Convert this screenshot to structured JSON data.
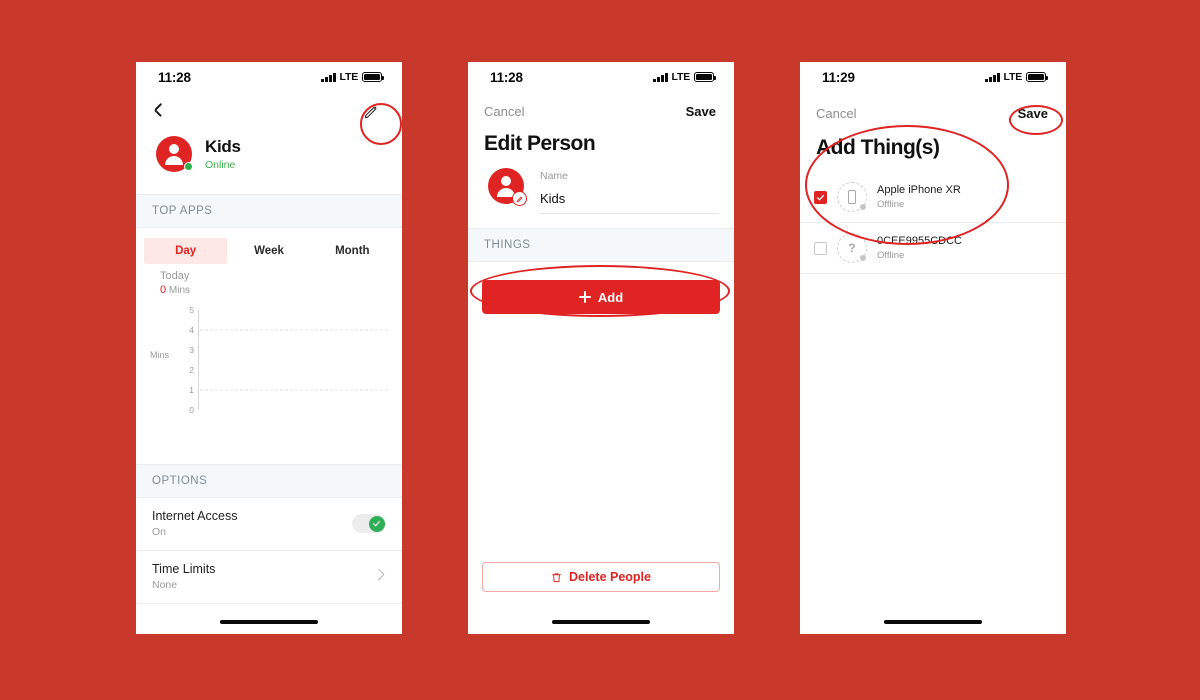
{
  "theme": {
    "page_background": "#C9392B",
    "brand_red": "#E02323",
    "online_green": "#3FAE4E",
    "muted_gray": "#9a9a9a",
    "section_bg": "#F5F8FA",
    "annotation_color": "#E02323"
  },
  "phone1": {
    "status_bar": {
      "time": "11:28",
      "network": "LTE",
      "signal_icon": "signal-bars-icon",
      "battery_icon": "battery-icon"
    },
    "nav": {
      "back_icon": "chevron-left-icon",
      "edit_icon": "pencil-icon"
    },
    "person": {
      "name": "Kids",
      "status": "Online",
      "avatar_icon": "person-avatar-icon",
      "online_dot": "online-status-dot"
    },
    "top_apps": {
      "header": "TOP APPS"
    },
    "range_tabs": [
      {
        "label": "Day",
        "active": true
      },
      {
        "label": "Week",
        "active": false
      },
      {
        "label": "Month",
        "active": false
      }
    ],
    "chart_data": {
      "type": "bar",
      "title": "Today",
      "value_label": "0",
      "value_unit": "Mins",
      "ylabel": "Mins",
      "xlabel": "",
      "categories": [],
      "values": [],
      "yticks": [
        "5",
        "4",
        "3",
        "2",
        "1",
        "0"
      ],
      "ylim": [
        0,
        5
      ],
      "gridlines_at": [
        1,
        4
      ],
      "grid": true,
      "legend": "none"
    },
    "options": {
      "header": "OPTIONS",
      "rows": [
        {
          "title": "Internet Access",
          "sub": "On",
          "control": "toggle-on"
        },
        {
          "title": "Time Limits",
          "sub": "None",
          "control": "chevron-right"
        }
      ]
    }
  },
  "phone2": {
    "status_bar": {
      "time": "11:28",
      "network": "LTE",
      "signal_icon": "signal-bars-icon",
      "battery_icon": "battery-icon"
    },
    "nav": {
      "cancel": "Cancel",
      "save": "Save"
    },
    "title": "Edit Person",
    "name_field": {
      "label": "Name",
      "value": "Kids",
      "avatar_icon": "person-avatar-edit-icon"
    },
    "things": {
      "header": "THINGS",
      "add_label": "Add",
      "add_icon": "plus-icon"
    },
    "delete": {
      "label": "Delete People",
      "icon": "trash-icon"
    }
  },
  "phone3": {
    "status_bar": {
      "time": "11:29",
      "network": "LTE",
      "signal_icon": "signal-bars-icon",
      "battery_icon": "battery-icon"
    },
    "nav": {
      "cancel": "Cancel",
      "save": "Save"
    },
    "title": "Add Thing(s)",
    "devices": [
      {
        "name": "Apple iPhone XR",
        "status": "Offline",
        "checked": true,
        "icon": "device-phone-icon"
      },
      {
        "name": "0CEE9955CDCC",
        "status": "Offline",
        "checked": false,
        "icon": "device-unknown-icon"
      }
    ]
  },
  "annotations": [
    {
      "name": "annotation-ellipse-edit-pencil",
      "shape": "ellipse"
    },
    {
      "name": "annotation-ellipse-add-button",
      "shape": "ellipse"
    },
    {
      "name": "annotation-ellipse-save-button",
      "shape": "ellipse"
    },
    {
      "name": "annotation-ellipse-thing-selection",
      "shape": "ellipse"
    }
  ]
}
